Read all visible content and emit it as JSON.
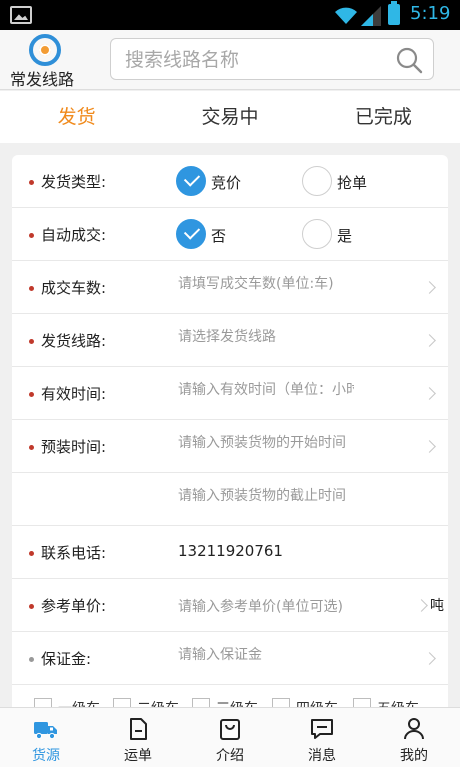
{
  "status_bar": {
    "time": "5:19"
  },
  "header": {
    "logo_label": "常发线路",
    "search_placeholder": "搜索线路名称"
  },
  "tabs": [
    {
      "label": "发货",
      "active": true
    },
    {
      "label": "交易中",
      "active": false
    },
    {
      "label": "已完成",
      "active": false
    }
  ],
  "form": {
    "ship_type": {
      "label": "发货类型:",
      "options": [
        "竞价",
        "抢单"
      ],
      "selected": "竞价"
    },
    "auto_deal": {
      "label": "自动成交:",
      "options": [
        "否",
        "是"
      ],
      "selected": "否"
    },
    "vehicles": {
      "label": "成交车数:",
      "placeholder": "请填写成交车数(单位:车)"
    },
    "route": {
      "label": "发货线路:",
      "placeholder": "请选择发货线路"
    },
    "valid_time": {
      "label": "有效时间:",
      "placeholder": "请输入有效时间（单位：小时）"
    },
    "load_time": {
      "label": "预装时间:",
      "start_placeholder": "请输入预装货物的开始时间",
      "end_placeholder": "请输入预装货物的截止时间"
    },
    "phone": {
      "label": "联系电话:",
      "value": "13211920761"
    },
    "ref_price": {
      "label": "参考单价:",
      "placeholder": "请输入参考单价(单位可选)",
      "unit": "吨"
    },
    "deposit": {
      "label": "保证金:",
      "placeholder": "请输入保证金"
    },
    "vehicle_levels": [
      "一级车",
      "二级车",
      "三级车",
      "四级车",
      "五级车"
    ]
  },
  "bottom_nav": [
    {
      "label": "货源",
      "icon": "truck-icon",
      "active": true
    },
    {
      "label": "运单",
      "icon": "document-icon",
      "active": false
    },
    {
      "label": "介绍",
      "icon": "bag-icon",
      "active": false
    },
    {
      "label": "消息",
      "icon": "message-icon",
      "active": false
    },
    {
      "label": "我的",
      "icon": "person-icon",
      "active": false
    }
  ],
  "colors": {
    "accent": "#f08a1c",
    "primary": "#2f96e0",
    "required_dot": "#c0392b"
  }
}
